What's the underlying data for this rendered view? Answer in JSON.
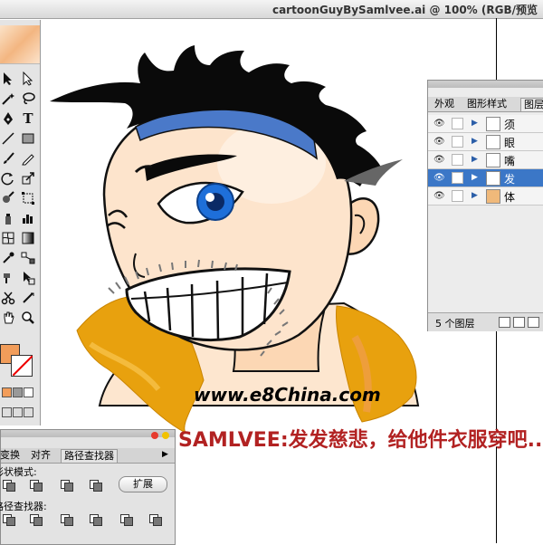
{
  "window": {
    "title": "cartoonGuyBySamlvee.ai @ 100% (RGB/预览"
  },
  "colors": {
    "fill": "#f29d5a",
    "selected_layer": "#3b77c7",
    "caption": "#b22222",
    "jacket": "#e8a10e"
  },
  "tools": {
    "icons": [
      "selection-arrow-icon",
      "direct-selection-icon",
      "magic-wand-icon",
      "lasso-icon",
      "pen-icon",
      "type-icon",
      "line-icon",
      "rectangle-icon",
      "paintbrush-icon",
      "pencil-icon",
      "rotate-icon",
      "scale-icon",
      "warp-icon",
      "free-transform-icon",
      "symbol-sprayer-icon",
      "graph-icon",
      "mesh-icon",
      "gradient-icon",
      "eyedropper-icon",
      "blend-icon",
      "live-paint-icon",
      "live-paint-select-icon",
      "scissors-icon",
      "slice-icon",
      "hand-icon",
      "zoom-icon"
    ]
  },
  "layers_panel": {
    "tabs": [
      "外观",
      "图形样式",
      "图层"
    ],
    "active_tab": "图层",
    "layers": [
      {
        "name": "须",
        "selected": false
      },
      {
        "name": "眼",
        "selected": false
      },
      {
        "name": "嘴",
        "selected": false
      },
      {
        "name": "发",
        "selected": true
      },
      {
        "name": "体",
        "selected": false
      }
    ],
    "footer": {
      "count_label": "5 个图层"
    }
  },
  "pathfinder_panel": {
    "tabs": [
      "变换",
      "对齐",
      "路径查找器"
    ],
    "active_tab": "路径查找器",
    "shape_modes_label": "形状模式:",
    "pathfinders_label": "路径查找器:",
    "expand_label": "扩展"
  },
  "artwork": {
    "watermark": "www.e8China.com",
    "caption_author": "SAMLVEE:",
    "caption_text": "发发慈悲，给他件衣服穿吧.."
  }
}
